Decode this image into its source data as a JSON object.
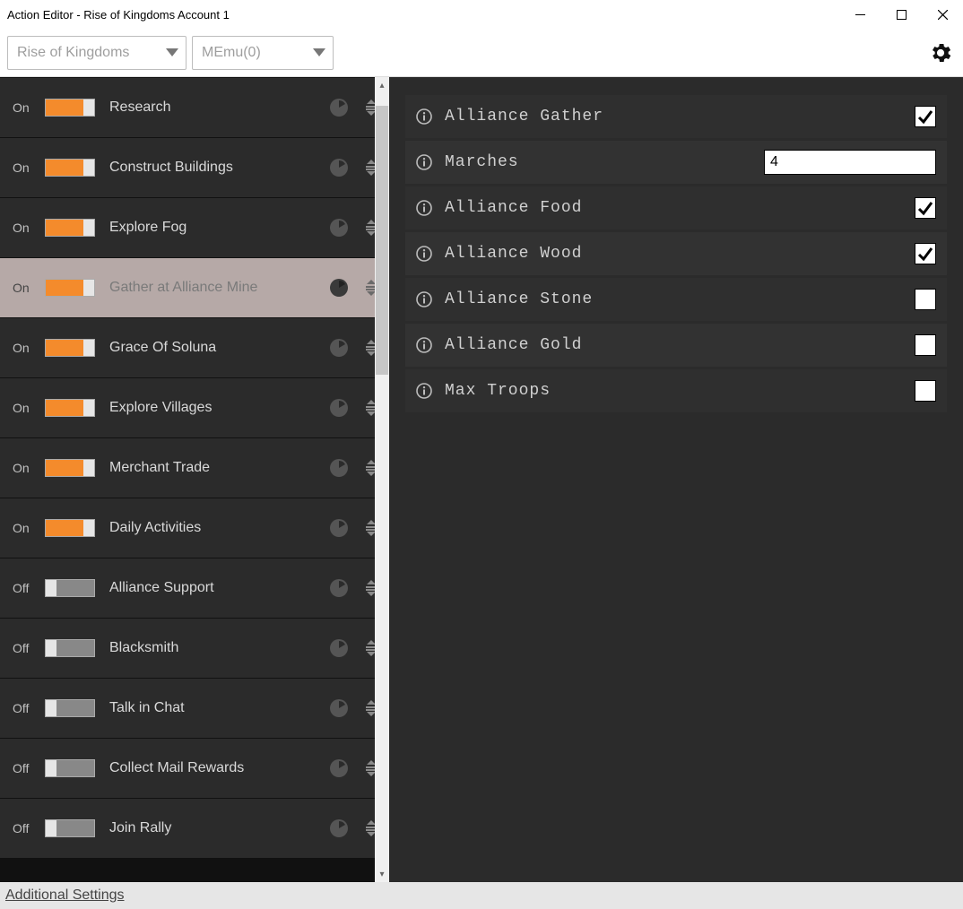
{
  "window": {
    "title": "Action Editor - Rise of Kingdoms Account 1"
  },
  "toolbar": {
    "game_dropdown": "Rise of Kingdoms",
    "emulator_dropdown": "MEmu(0)"
  },
  "actions": [
    {
      "state": "On",
      "label": "Research",
      "selected": false
    },
    {
      "state": "On",
      "label": "Construct Buildings",
      "selected": false
    },
    {
      "state": "On",
      "label": "Explore Fog",
      "selected": false
    },
    {
      "state": "On",
      "label": "Gather at Alliance Mine",
      "selected": true
    },
    {
      "state": "On",
      "label": "Grace Of Soluna",
      "selected": false
    },
    {
      "state": "On",
      "label": "Explore Villages",
      "selected": false
    },
    {
      "state": "On",
      "label": "Merchant Trade",
      "selected": false
    },
    {
      "state": "On",
      "label": "Daily Activities",
      "selected": false
    },
    {
      "state": "Off",
      "label": "Alliance Support",
      "selected": false
    },
    {
      "state": "Off",
      "label": "Blacksmith",
      "selected": false
    },
    {
      "state": "Off",
      "label": "Talk in Chat",
      "selected": false
    },
    {
      "state": "Off",
      "label": "Collect Mail Rewards",
      "selected": false
    },
    {
      "state": "Off",
      "label": "Join Rally",
      "selected": false
    }
  ],
  "settings": [
    {
      "label": "Alliance Gather",
      "type": "checkbox",
      "value": true
    },
    {
      "label": "Marches",
      "type": "text",
      "value": "4"
    },
    {
      "label": "Alliance Food",
      "type": "checkbox",
      "value": true
    },
    {
      "label": "Alliance Wood",
      "type": "checkbox",
      "value": true
    },
    {
      "label": "Alliance Stone",
      "type": "checkbox",
      "value": false
    },
    {
      "label": "Alliance Gold",
      "type": "checkbox",
      "value": false
    },
    {
      "label": "Max Troops",
      "type": "checkbox",
      "value": false
    }
  ],
  "footer": {
    "link": "Additional Settings"
  }
}
